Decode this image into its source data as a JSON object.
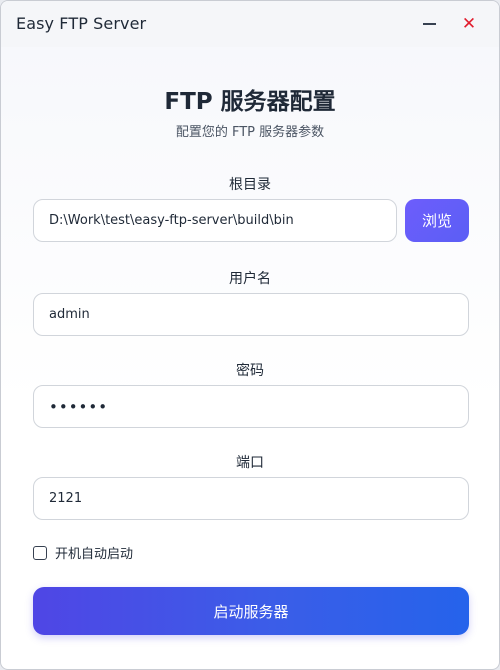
{
  "window": {
    "title": "Easy FTP Server",
    "minimize_icon": "minimize-icon",
    "close_icon": "close-icon",
    "close_glyph": "✕"
  },
  "header": {
    "title": "FTP 服务器配置",
    "subtitle": "配置您的 FTP 服务器参数"
  },
  "form": {
    "root_dir": {
      "label": "根目录",
      "value": "D:\\Work\\test\\easy-ftp-server\\build\\bin",
      "browse_label": "浏览"
    },
    "username": {
      "label": "用户名",
      "value": "admin"
    },
    "password": {
      "label": "密码",
      "value": "••••••"
    },
    "port": {
      "label": "端口",
      "value": "2121"
    },
    "autostart": {
      "label": "开机自动启动",
      "checked": false
    },
    "start_label": "启动服务器"
  },
  "colors": {
    "accent": "#5b5ef5",
    "start_gradient_from": "#4f46e5",
    "start_gradient_to": "#2563eb",
    "close_icon": "#e11d2e"
  }
}
